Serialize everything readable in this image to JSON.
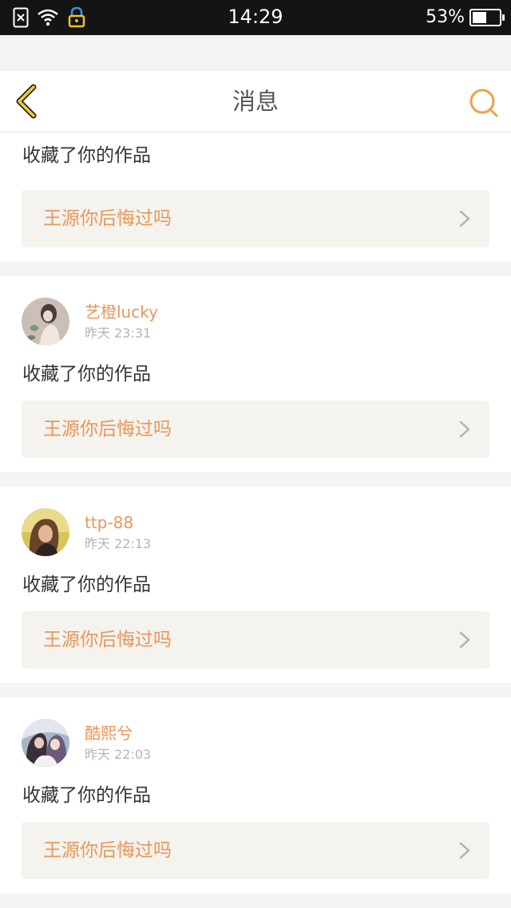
{
  "status_bar": {
    "time": "14:29",
    "battery_text": "53%",
    "battery_level": 0.53,
    "icons": [
      "sim-x-icon",
      "wifi-icon",
      "lock-icon",
      "battery-icon"
    ]
  },
  "nav": {
    "title": "消息",
    "back_icon": "chevron-left-icon",
    "search_icon": "search-icon",
    "accent_color": "#f0a050"
  },
  "notifications": [
    {
      "action": "收藏了你的作品",
      "work_title": "王源你后悔过吗"
    },
    {
      "username": "艺橙lucky",
      "time": "昨天 23:31",
      "action": "收藏了你的作品",
      "work_title": "王源你后悔过吗"
    },
    {
      "username": "ttp-88",
      "time": "昨天 22:13",
      "action": "收藏了你的作品",
      "work_title": "王源你后悔过吗"
    },
    {
      "username": "酷熙兮",
      "time": "昨天 22:03",
      "action": "收藏了你的作品",
      "work_title": "王源你后悔过吗"
    }
  ]
}
